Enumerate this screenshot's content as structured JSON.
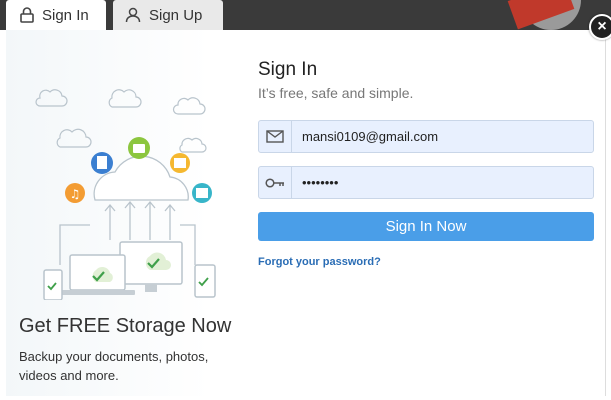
{
  "tabs": {
    "signin_label": "Sign In",
    "signup_label": "Sign Up"
  },
  "promo": {
    "title": "Get FREE Storage Now",
    "text": "Backup your documents, photos, videos and more."
  },
  "form": {
    "title": "Sign In",
    "subtitle": "It’s free, safe and simple.",
    "email_value": "mansi0109@gmail.com",
    "password_value": "••••••••",
    "submit_label": "Sign In Now",
    "forgot_label": "Forgot your password?"
  },
  "colors": {
    "accent": "#4a9ee8",
    "link": "#2a6db5",
    "field_bg": "#e8f0fe"
  },
  "icons": {
    "close": "×"
  }
}
